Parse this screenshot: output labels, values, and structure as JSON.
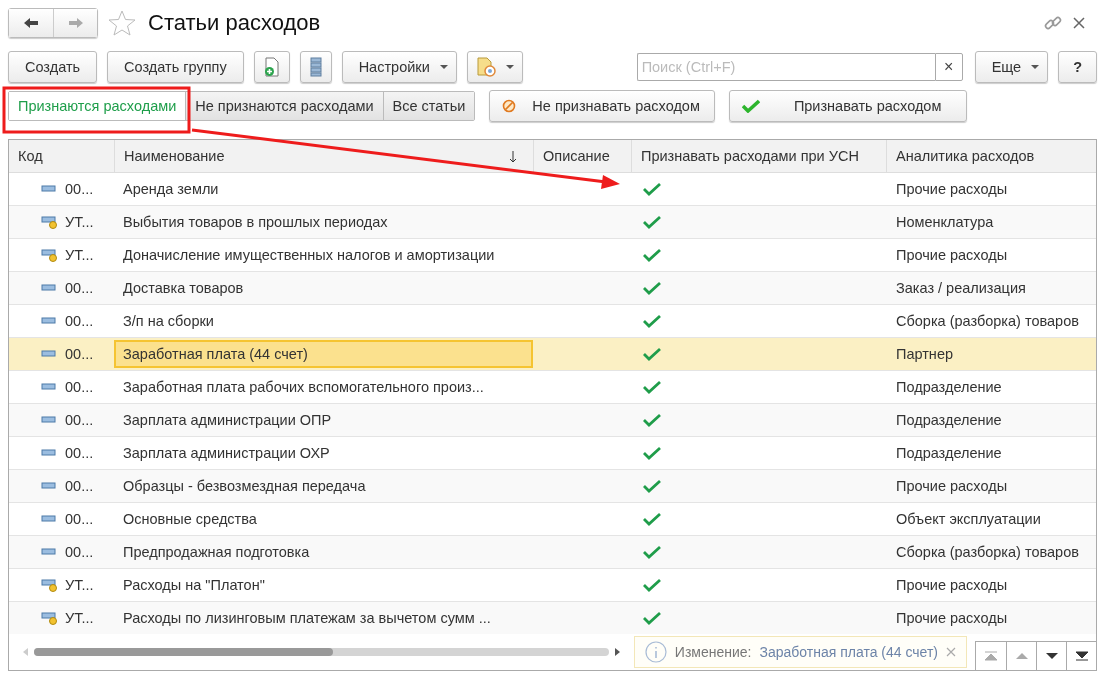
{
  "window": {
    "title": "Статьи расходов",
    "favorite": false
  },
  "toolbar": {
    "create": "Создать",
    "create_group": "Создать группу",
    "settings": "Настройки",
    "search": {
      "placeholder": "Поиск (Ctrl+F)",
      "clear": "×"
    },
    "more": "Еще",
    "help": "?"
  },
  "filters": [
    {
      "label": "Признаются расходами",
      "selected": true
    },
    {
      "label": "Не признаются расходами",
      "selected": false
    },
    {
      "label": "Все статьи",
      "selected": false
    }
  ],
  "actions": [
    {
      "label": "Не признавать расходом",
      "kind": "deny"
    },
    {
      "label": "Признавать расходом",
      "kind": "accept"
    }
  ],
  "table": {
    "columns": [
      "Код",
      "Наименование",
      "Описание",
      "Признавать расходами при УСН",
      "Аналитика расходов"
    ],
    "rows": [
      {
        "kind": "plain",
        "code": "00...",
        "name": "Аренда земли",
        "usn": true,
        "analytics": "Прочие расходы",
        "selected": false
      },
      {
        "kind": "marked",
        "code": "УТ...",
        "name": "Выбытия товаров в прошлых периодах",
        "usn": true,
        "analytics": "Номенклатура",
        "selected": false
      },
      {
        "kind": "marked",
        "code": "УТ...",
        "name": "Доначисление имущественных налогов и амортизации",
        "usn": true,
        "analytics": "Прочие расходы",
        "selected": false
      },
      {
        "kind": "plain",
        "code": "00...",
        "name": "Доставка товаров",
        "usn": true,
        "analytics": "Заказ / реализация",
        "selected": false
      },
      {
        "kind": "plain",
        "code": "00...",
        "name": "З/п на сборки",
        "usn": true,
        "analytics": "Сборка (разборка) товаров",
        "selected": false
      },
      {
        "kind": "plain",
        "code": "00...",
        "name": "Заработная плата (44 счет)",
        "usn": true,
        "analytics": "Партнер",
        "selected": true
      },
      {
        "kind": "plain",
        "code": "00...",
        "name": "Заработная плата рабочих вспомогательного произ...",
        "usn": true,
        "analytics": "Подразделение",
        "selected": false
      },
      {
        "kind": "plain",
        "code": "00...",
        "name": "Зарплата администрации ОПР",
        "usn": true,
        "analytics": "Подразделение",
        "selected": false
      },
      {
        "kind": "plain",
        "code": "00...",
        "name": "Зарплата администрации ОХР",
        "usn": true,
        "analytics": "Подразделение",
        "selected": false
      },
      {
        "kind": "plain",
        "code": "00...",
        "name": "Образцы - безвозмездная передача",
        "usn": true,
        "analytics": "Прочие расходы",
        "selected": false
      },
      {
        "kind": "plain",
        "code": "00...",
        "name": "Основные средства",
        "usn": true,
        "analytics": "Объект эксплуатации",
        "selected": false
      },
      {
        "kind": "plain",
        "code": "00...",
        "name": "Предпродажная подготовка",
        "usn": true,
        "analytics": "Сборка (разборка) товаров",
        "selected": false
      },
      {
        "kind": "marked",
        "code": "УТ...",
        "name": "Расходы на \"Платон\"",
        "usn": true,
        "analytics": "Прочие расходы",
        "selected": false
      },
      {
        "kind": "marked",
        "code": "УТ...",
        "name": "Расходы по лизинговым платежам за вычетом сумм ...",
        "usn": true,
        "analytics": "Прочие расходы",
        "selected": false
      }
    ]
  },
  "notification": {
    "title": "Изменение:",
    "text": "Заработная плата (44 счет)"
  }
}
